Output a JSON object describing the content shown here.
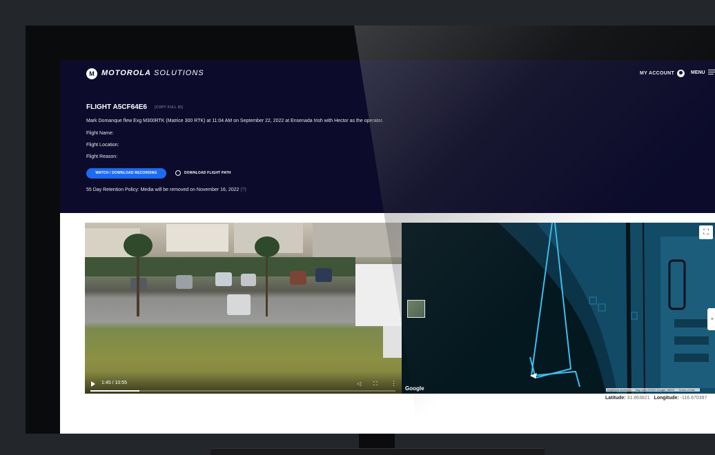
{
  "header": {
    "brand_logo_letter": "M",
    "brand_bold": "MOTOROLA",
    "brand_light": "SOLUTIONS",
    "my_account_label": "MY ACCOUNT",
    "menu_label": "MENU"
  },
  "flight": {
    "title": "FLIGHT A5CF64E6",
    "copy_link_label": "[COPY FULL ID]",
    "description": "Mark Domanque flew Exg M300RTK (Matrice 300 RTK) at 11:04 AM on September 22, 2022 at Ensenada Irish with Hector as the operator.",
    "name_label": "Flight Name:",
    "location_label": "Flight Location:",
    "reason_label": "Flight Reason:",
    "watch_button": "WATCH / DOWNLOAD RECORDING",
    "download_path_button": "DOWNLOAD FLIGHT PATH",
    "retention_text": "55 Day Retention Policy: Media will be removed on November 16, 2022",
    "retention_help": "(?)"
  },
  "video": {
    "timecode": "1:45 / 10:55",
    "progress_fraction": 0.16
  },
  "map": {
    "google_label": "Google",
    "attribution": [
      "Keyboard shortcuts",
      "Map data ©2022 Google, INEGI",
      "Terms of Use"
    ],
    "fullscreen_icon": "fullscreen-icon",
    "zoom_icon": "zoom-control-icon"
  },
  "coordinates": {
    "latitude_label": "Latitude:",
    "latitude_value": "31.863821",
    "longitude_label": "Longitude:",
    "longitude_value": "-116.670397"
  }
}
